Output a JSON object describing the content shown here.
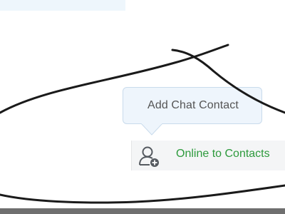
{
  "tooltip": {
    "label": "Add Chat Contact"
  },
  "status": {
    "label": "Online to Contacts",
    "icon": "add-contact-icon",
    "color": "#2d9a3c"
  },
  "colors": {
    "tooltip_bg": "#eef5fc",
    "status_bg": "#f4f5f6",
    "top_bar": "#eef6fc",
    "bottom_bar": "#6f6f6f"
  }
}
